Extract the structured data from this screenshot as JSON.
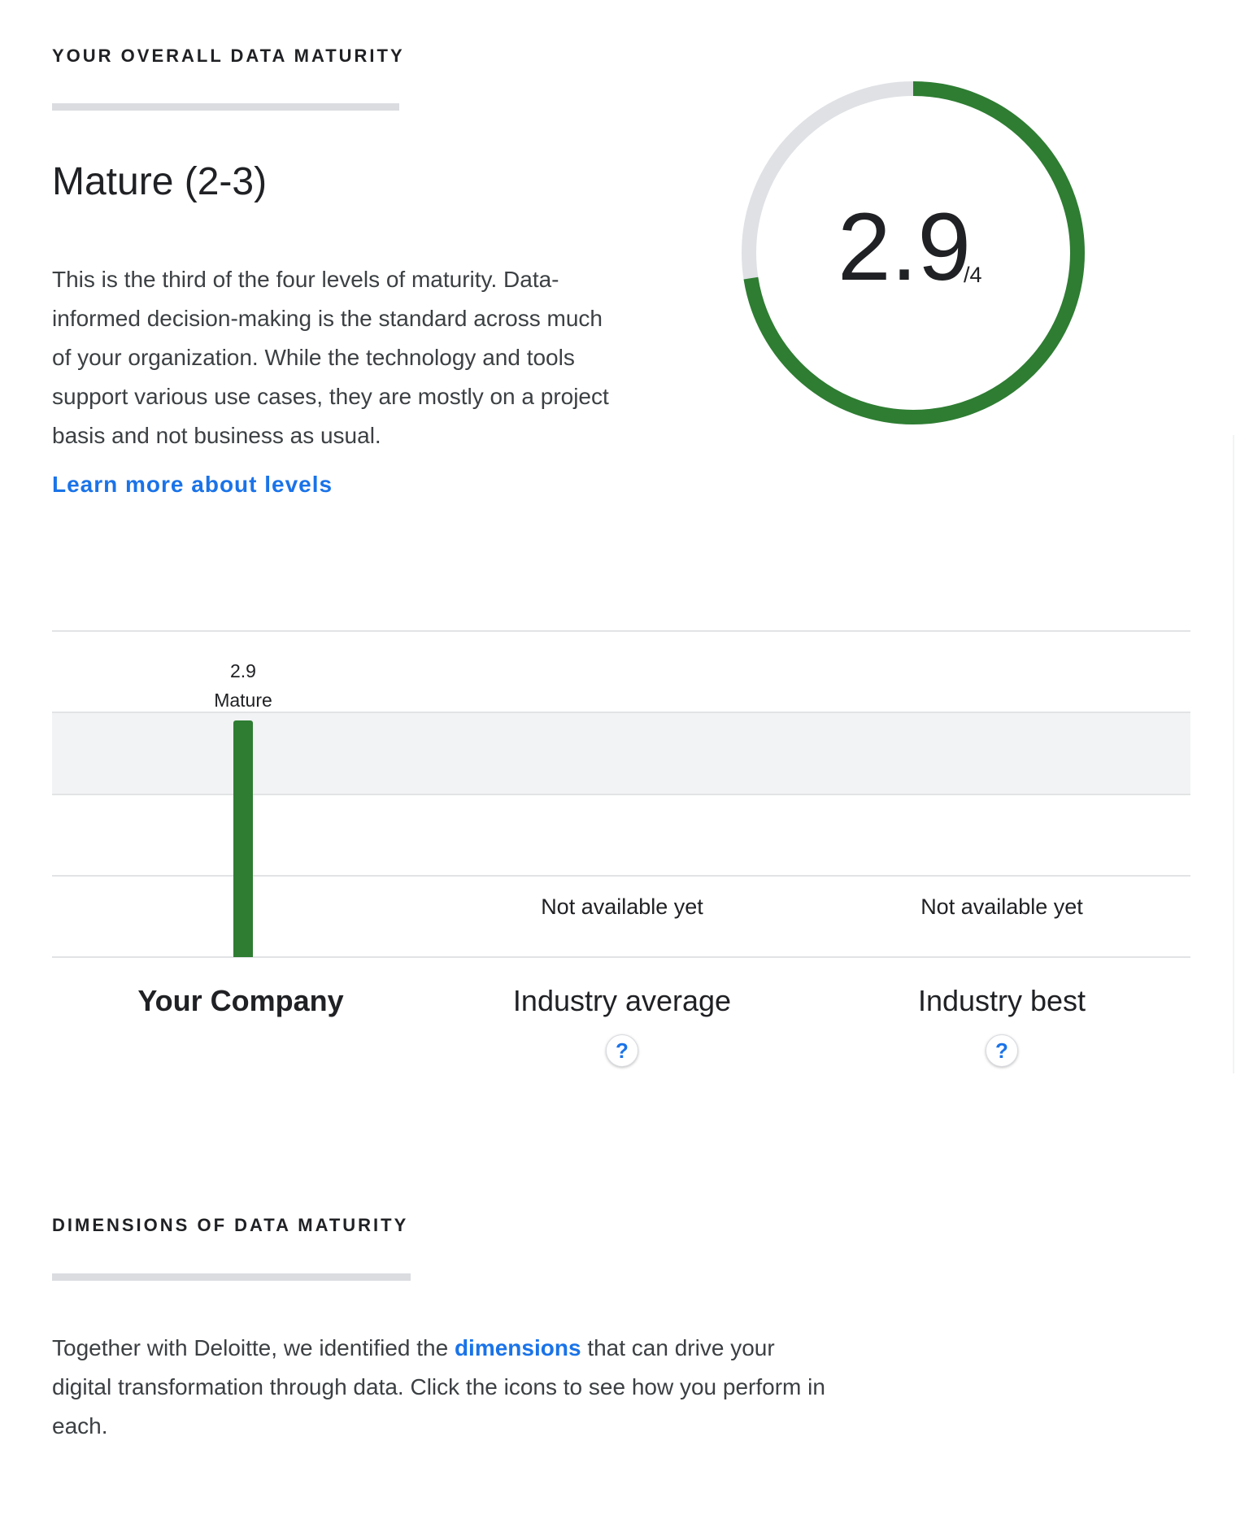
{
  "overall": {
    "heading": "YOUR OVERALL DATA MATURITY",
    "level_title": "Mature (2-3)",
    "description": "This is the third of the four levels of maturity. Data-informed decision-making is the standard across much of your organization. While the technology and tools support various use cases, they are mostly on a project basis and not business as usual.",
    "learn_more": "Learn more about levels",
    "score": {
      "value": 2.9,
      "max": 4,
      "value_text": "2.9",
      "max_text": "/4"
    }
  },
  "chart_data": {
    "type": "bar",
    "categories": [
      "Your Company",
      "Industry average",
      "Industry best"
    ],
    "values": [
      2.9,
      null,
      null
    ],
    "value_labels": [
      "2.9",
      "",
      ""
    ],
    "level_labels": [
      "Mature",
      "",
      ""
    ],
    "unavailable_text": [
      "",
      "Not available yet",
      "Not available yet"
    ],
    "ylim": [
      0,
      4
    ],
    "highlight_band": [
      2,
      3
    ],
    "grid": true
  },
  "dimensions": {
    "heading": "DIMENSIONS OF DATA MATURITY",
    "desc_before": "Together with Deloitte, we identified the ",
    "desc_link": "dimensions",
    "desc_after": " that can drive your digital transformation through data. Click the icons to see how you perform in each."
  },
  "colors": {
    "accent_green": "#2e7d32",
    "track_gray": "#dfe1e5",
    "link_blue": "#1a73e8",
    "band_gray": "#f1f3f4"
  },
  "icons": {
    "help": "question-mark-icon",
    "help_glyph": "?"
  }
}
